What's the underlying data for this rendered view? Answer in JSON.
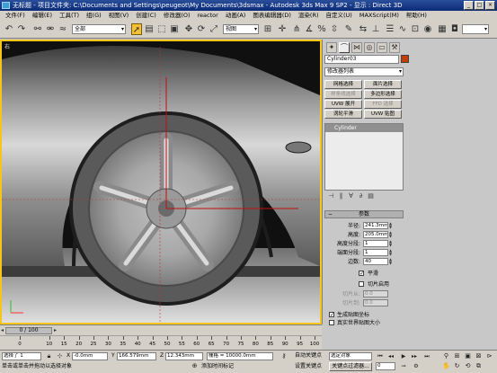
{
  "window": {
    "title": "无标题  - 项目文件夹: C:\\Documents and Settings\\peugeot\\My Documents\\3dsmax   - Autodesk 3ds Max 9 SP2   - 显示 : Direct 3D",
    "buttons": [
      "_",
      "□",
      "×"
    ]
  },
  "menu": [
    "文件(F)",
    "编辑(E)",
    "工具(T)",
    "组(G)",
    "视图(V)",
    "创建(C)",
    "修改器(O)",
    "reactor",
    "动画(A)",
    "图表编辑器(D)",
    "渲染(R)",
    "自定义(U)",
    "MAXScript(M)",
    "帮助(H)"
  ],
  "toolbar": {
    "selection_filter": "全部",
    "reference_coord": "视图",
    "named_selection": ""
  },
  "viewport": {
    "label": "右"
  },
  "command_panel": {
    "object_name": "Cylinder03",
    "object_color": "#c43e00",
    "modifier_list": "修改器列表",
    "modifier_buttons": [
      "网格选择",
      "面片选择",
      "样条线选择",
      "多边形选择",
      "UVW 展开",
      "FFD 选择",
      "涡轮平滑",
      "UVW 贴图"
    ],
    "stack_item": "Cylinder",
    "rollout_title": "参数",
    "params": {
      "radius_label": "半径:",
      "radius_value": "241.3mm",
      "height_label": "高度:",
      "height_value": "205.0mm",
      "height_segs_label": "高度分段:",
      "height_segs_value": "1",
      "cap_segs_label": "端面分段:",
      "cap_segs_value": "1",
      "sides_label": "边数:",
      "sides_value": "40",
      "smooth_label": "平滑",
      "slice_on_label": "切片启用",
      "slice_from_label": "切片从:",
      "slice_from_value": "0.0",
      "slice_to_label": "切片到:",
      "slice_to_value": "0.0",
      "gen_mapping_label": "生成贴图坐标",
      "real_world_label": "真实世界贴图大小"
    }
  },
  "timeline": {
    "frame_display": "0 / 100",
    "ticks": [
      "0",
      "10",
      "15",
      "20",
      "25",
      "30",
      "35",
      "40",
      "45",
      "50",
      "55",
      "60",
      "65",
      "70",
      "75",
      "80",
      "85",
      "90",
      "95",
      "100"
    ]
  },
  "status": {
    "selection": "选择了 1",
    "x_label": "X",
    "x_value": "-0.0mm",
    "y_label": "Y",
    "y_value": "166.579mm",
    "z_label": "Z",
    "z_value": "12.343mm",
    "grid": "栅格 = 10000.0mm",
    "prompt": "单击或单击并拖动以选择对象",
    "add_time_tag": "添加时间标记",
    "auto_key": "自动关键点",
    "set_key": "设置关键点",
    "key_filter_select": "选定对象",
    "key_filters": "关键点过滤器...",
    "frame_field": "0"
  }
}
